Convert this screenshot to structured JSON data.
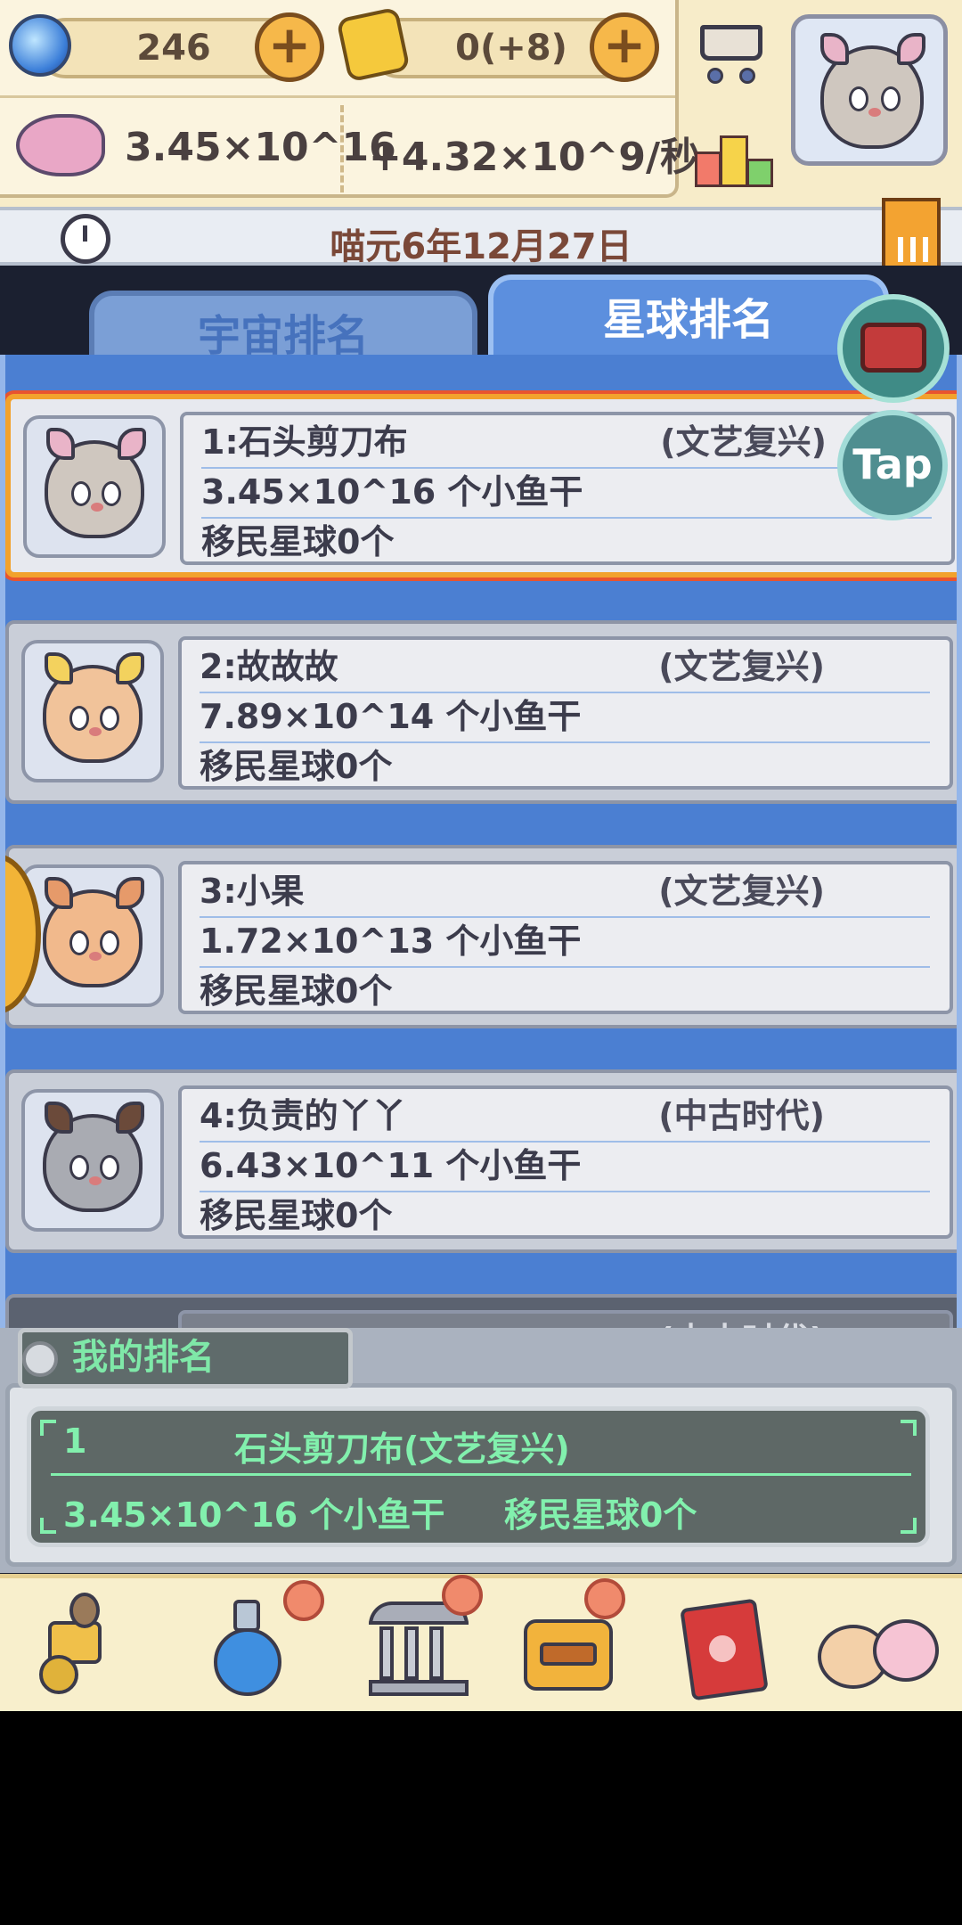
{
  "header": {
    "gems": "246",
    "coins": "0(+8)",
    "fish_total": "3.45×10^16",
    "fish_rate": "+4.32×10^9/秒"
  },
  "date": "喵元6年12月27日",
  "tabs": [
    {
      "label": "宇宙排名",
      "active": false
    },
    {
      "label": "星球排名",
      "active": true
    }
  ],
  "tap_label": "Tap",
  "rankings": [
    {
      "name_line": "1:石头剪刀布",
      "era": "(文艺复兴)",
      "fish": "3.45×10^16 个小鱼干",
      "migrants": "移民星球0个"
    },
    {
      "name_line": "2:故故故",
      "era": "(文艺复兴)",
      "fish": "7.89×10^14 个小鱼干",
      "migrants": "移民星球0个"
    },
    {
      "name_line": "3:小果",
      "era": "(文艺复兴)",
      "fish": "1.72×10^13 个小鱼干",
      "migrants": "移民星球0个"
    },
    {
      "name_line": "4:负责的丫丫",
      "era": "(中古时代)",
      "fish": "6.43×10^11 个小鱼干",
      "migrants": "移民星球0个"
    },
    {
      "era": "(中古时代)"
    }
  ],
  "my_rank": {
    "title": "我的排名",
    "rank": "1",
    "name": "石头剪刀布(文艺复兴)",
    "fish": "3.45×10^16 个小鱼干",
    "migrants": "移民星球0个"
  },
  "icons": {
    "gem": "gem-icon",
    "coin": "coin-scroll-icon",
    "fish": "fish-icon",
    "cart": "cart-icon",
    "leaderboard": "podium-icon",
    "clock": "clock-icon",
    "museum": "museum-icon",
    "chest": "treasure-chest-icon"
  },
  "colors": {
    "accent_blue": "#4b7fd2",
    "highlight_orange": "#f2a22d",
    "screen_green": "#82f0ad"
  }
}
